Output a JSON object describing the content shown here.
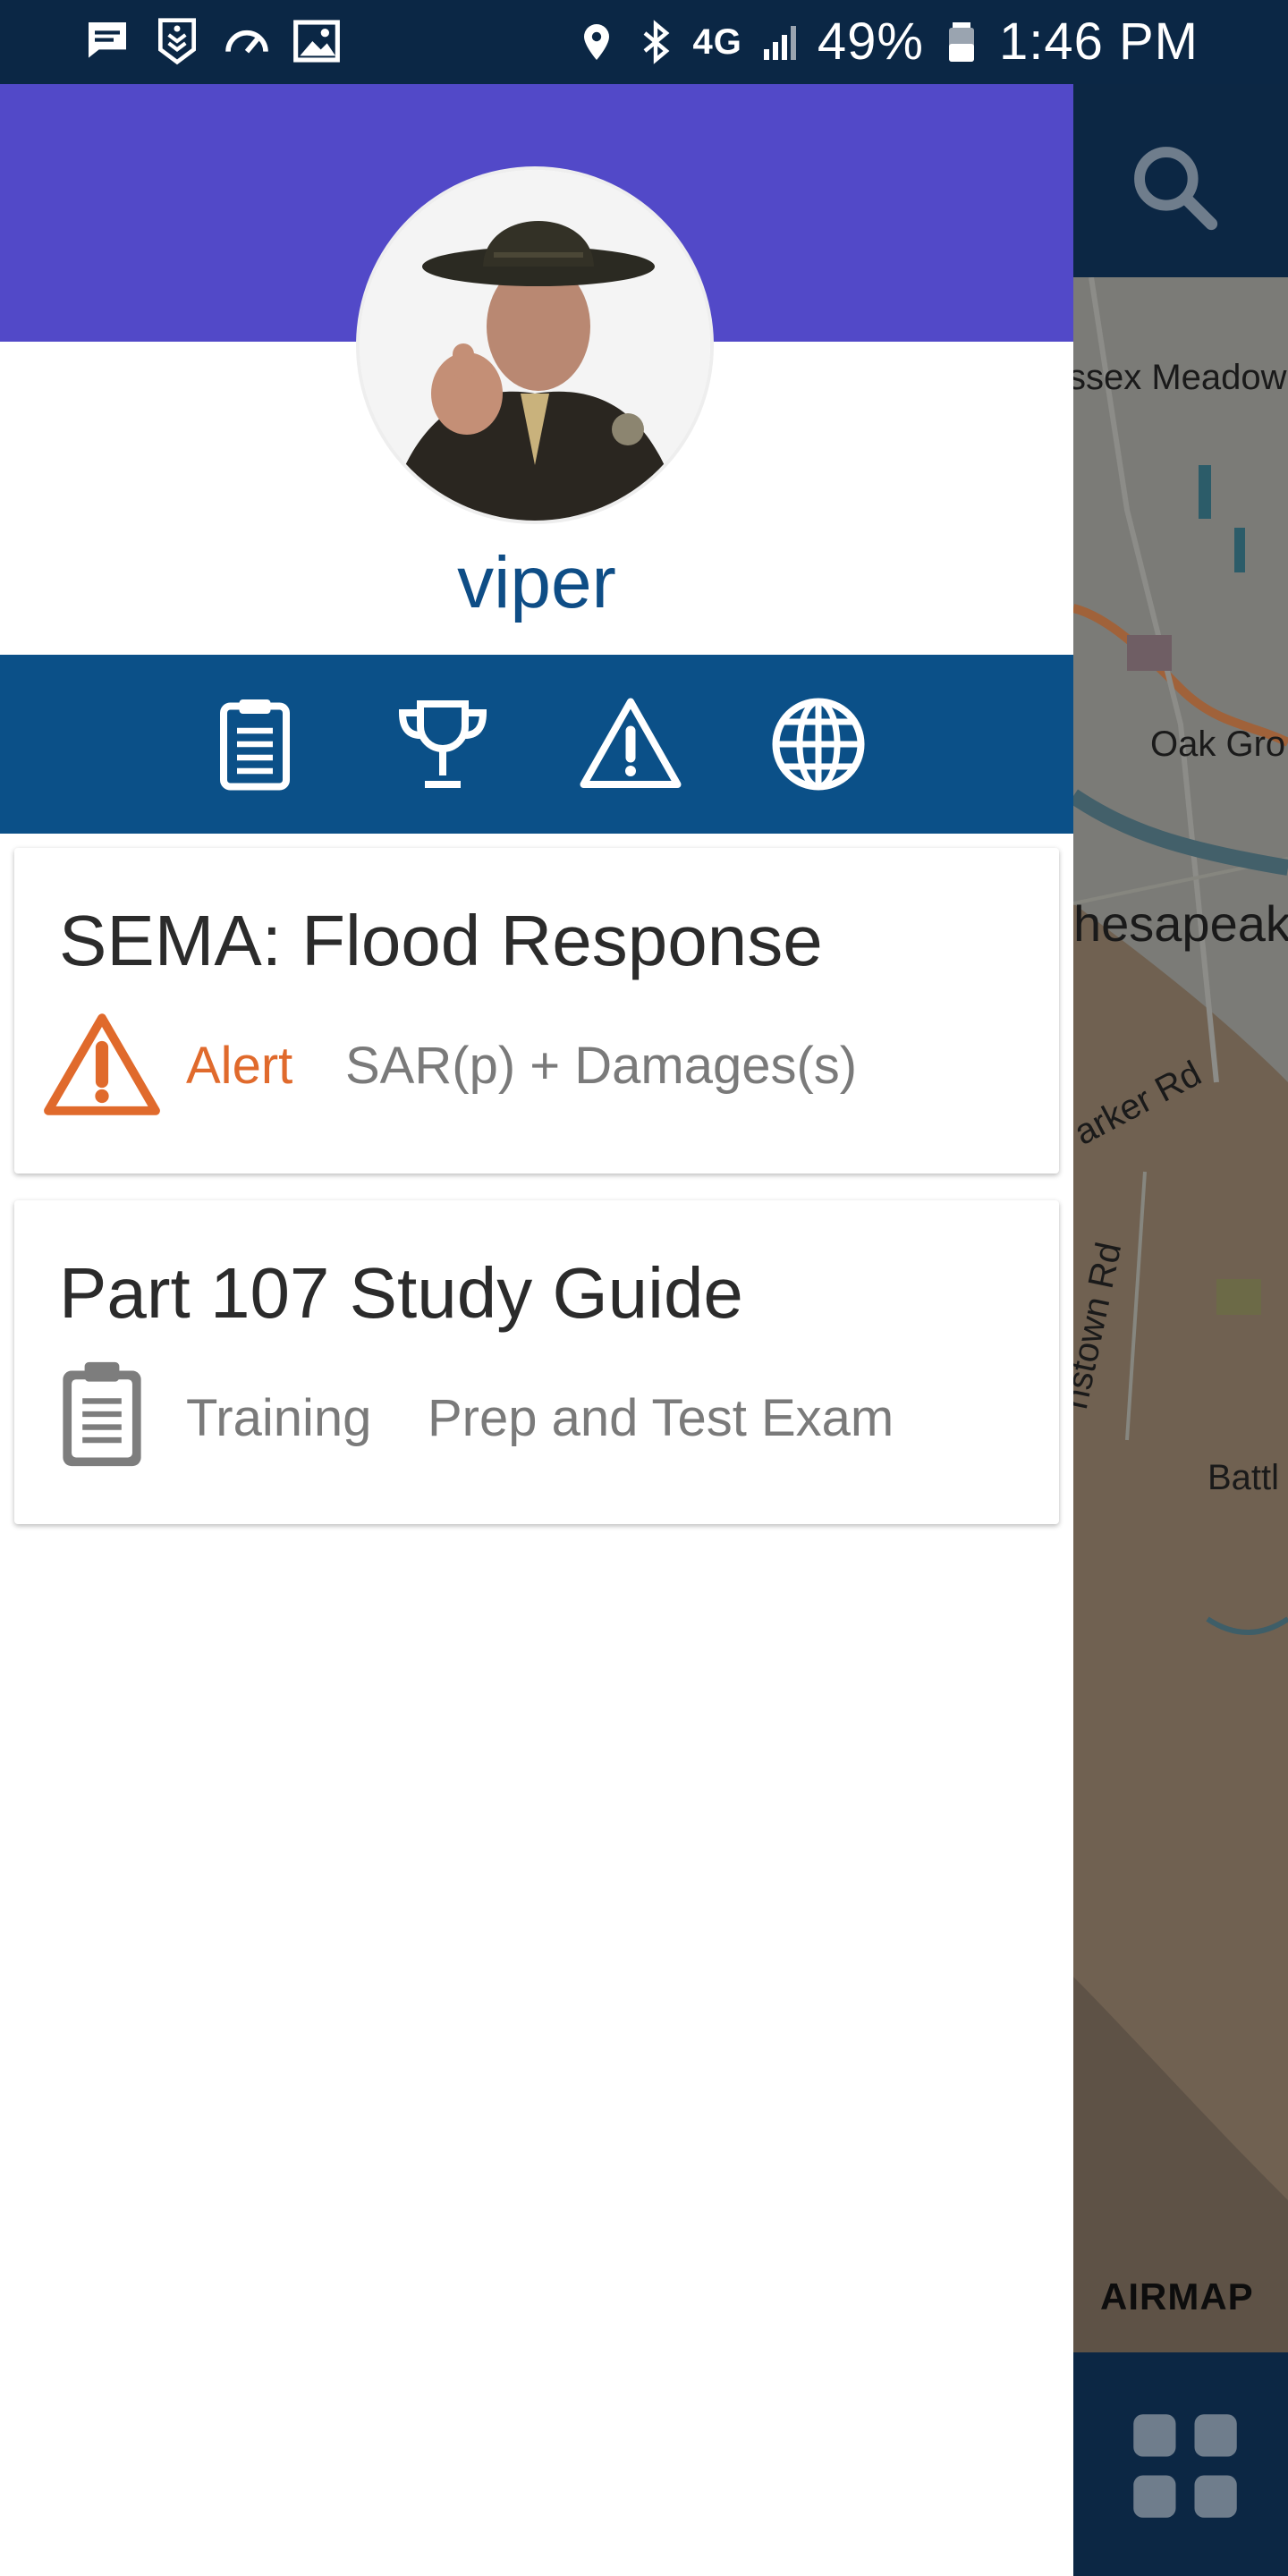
{
  "status_bar": {
    "battery": "49%",
    "time": "1:46 PM",
    "network": "4G",
    "icons": [
      "message-icon",
      "shield-badge-icon",
      "speedometer-icon",
      "image-icon",
      "location-pin-icon",
      "bluetooth-icon",
      "4g-lte-icon",
      "signal-icon",
      "battery-icon"
    ]
  },
  "profile": {
    "username": "viper",
    "header_color": "#5249c8"
  },
  "drawer_nav": {
    "color": "#0b5088",
    "items": [
      {
        "icon": "clipboard-icon"
      },
      {
        "icon": "trophy-icon"
      },
      {
        "icon": "alert-triangle-icon"
      },
      {
        "icon": "globe-icon"
      }
    ]
  },
  "cards": [
    {
      "title": "SEMA: Flood Response",
      "tag": "Alert",
      "tag_color": "#e06a2c",
      "icon": "alert-triangle-icon",
      "description": "SAR(p) + Damages(s)"
    },
    {
      "title": "Part 107 Study Guide",
      "tag": "Training",
      "tag_color": "#7a7a7a",
      "icon": "clipboard-icon",
      "description": "Prep and Test Exam"
    }
  ],
  "map": {
    "labels": [
      "ssex Meadow",
      "Oak Gro",
      "hesapeak",
      "arker Rd",
      "nstown Rd",
      "Battl"
    ],
    "brand": "AIRMAP",
    "icons": [
      "search-icon",
      "grid-menu-icon"
    ]
  }
}
